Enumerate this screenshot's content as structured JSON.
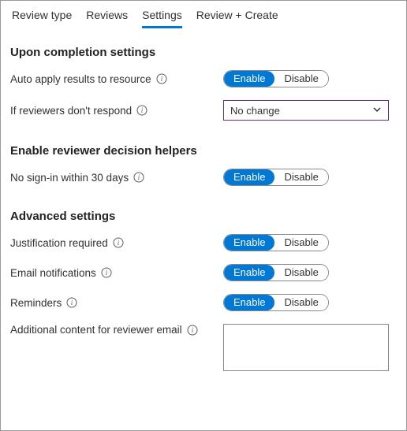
{
  "tabs": {
    "review_type": "Review type",
    "reviews": "Reviews",
    "settings": "Settings",
    "review_create": "Review + Create"
  },
  "toggle_labels": {
    "enable": "Enable",
    "disable": "Disable"
  },
  "sections": {
    "completion": {
      "title": "Upon completion settings",
      "auto_apply_label": "Auto apply results to resource",
      "no_respond_label": "If reviewers don't respond",
      "no_respond_value": "No change"
    },
    "helpers": {
      "title": "Enable reviewer decision helpers",
      "no_signin_label": "No sign-in within 30 days"
    },
    "advanced": {
      "title": "Advanced settings",
      "justification_label": "Justification required",
      "email_notif_label": "Email notifications",
      "reminders_label": "Reminders",
      "additional_content_label": "Additional content for reviewer email",
      "additional_content_value": ""
    }
  }
}
